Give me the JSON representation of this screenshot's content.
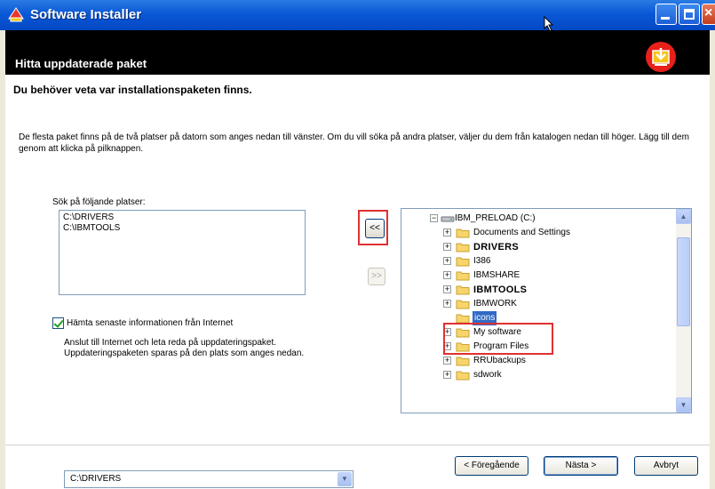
{
  "window": {
    "title": "Software Installer"
  },
  "header": {
    "title": "Hitta uppdaterade paket"
  },
  "content": {
    "subheading": "Du behöver veta var installationspaketen finns.",
    "description": "De flesta paket finns på de två platser på datorn som anges nedan till vänster.  Om du vill söka på andra platser, väljer du dem från katalogen nedan till höger.  Lägg till dem genom att klicka på pilknappen.",
    "search_label": "Sök på följande platser:",
    "locations": [
      "C:\\DRIVERS",
      "C:\\IBMTOOLS"
    ],
    "add_button": "<<",
    "remove_button": ">>",
    "internet_checkbox": {
      "label": "Hämta senaste informationen från Internet",
      "checked": true
    },
    "internet_description": "Anslut till Internet och leta reda på uppdateringspaket. Uppdateringspaketen sparas på den plats som anges nedan.",
    "directory_select": {
      "value": "C:\\DRIVERS"
    }
  },
  "tree": {
    "drive": "IBM_PRELOAD (C:)",
    "folders": [
      {
        "label": "Documents and Settings"
      },
      {
        "label": "DRIVERS"
      },
      {
        "label": "I386"
      },
      {
        "label": "IBMSHARE"
      },
      {
        "label": "IBMTOOLS"
      },
      {
        "label": "IBMWORK"
      },
      {
        "label": "icons"
      },
      {
        "label": "My software"
      },
      {
        "label": "Program Files"
      },
      {
        "label": "RRUbackups"
      },
      {
        "label": "sdwork"
      }
    ]
  },
  "buttons": {
    "back": "< Föregående",
    "next": "Nästa >",
    "cancel": "Avbryt"
  },
  "colors": {
    "titlebar": "#0a58d6",
    "selection": "#316ac5",
    "highlight": "#e03030",
    "header": "#000000"
  },
  "icons": [
    "installer-icon",
    "minimize-icon",
    "maximize-icon",
    "close-icon",
    "download-icon",
    "folder-icon",
    "drive-icon",
    "mouse-cursor-icon"
  ]
}
